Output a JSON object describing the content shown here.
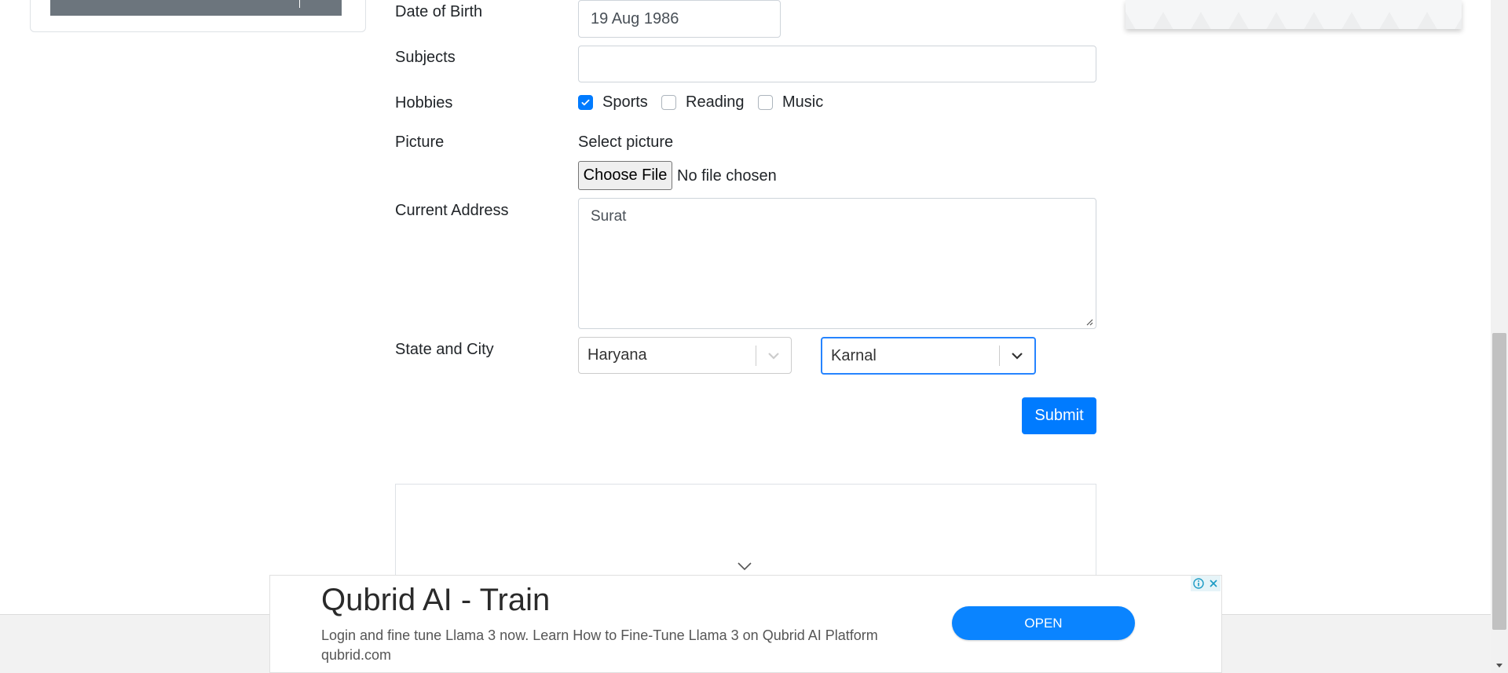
{
  "form": {
    "date_of_birth": {
      "label": "Date of Birth",
      "value": "19 Aug 1986"
    },
    "subjects": {
      "label": "Subjects",
      "value": ""
    },
    "hobbies": {
      "label": "Hobbies",
      "options": [
        {
          "label": "Sports",
          "checked": true
        },
        {
          "label": "Reading",
          "checked": false
        },
        {
          "label": "Music",
          "checked": false
        }
      ]
    },
    "picture": {
      "label": "Picture",
      "select_label": "Select picture",
      "button_label": "Choose File",
      "file_status": "No file chosen"
    },
    "current_address": {
      "label": "Current Address",
      "value": "Surat"
    },
    "state_city": {
      "label": "State and City",
      "state": "Haryana",
      "city": "Karnal"
    },
    "submit_label": "Submit"
  },
  "ad": {
    "title": "Qubrid AI - Train",
    "body": "Login and fine tune Llama 3 now. Learn How to Fine-Tune Llama 3 on Qubrid AI Platform qubrid.com",
    "cta": "OPEN"
  },
  "colors": {
    "primary": "#007bff",
    "focus_border": "#2684ff",
    "ad_button": "#0a84ff"
  },
  "icons": [
    "check-icon",
    "chevron-down-icon",
    "info-icon",
    "close-icon",
    "resize-grip-icon",
    "scroll-down-arrow-icon"
  ]
}
